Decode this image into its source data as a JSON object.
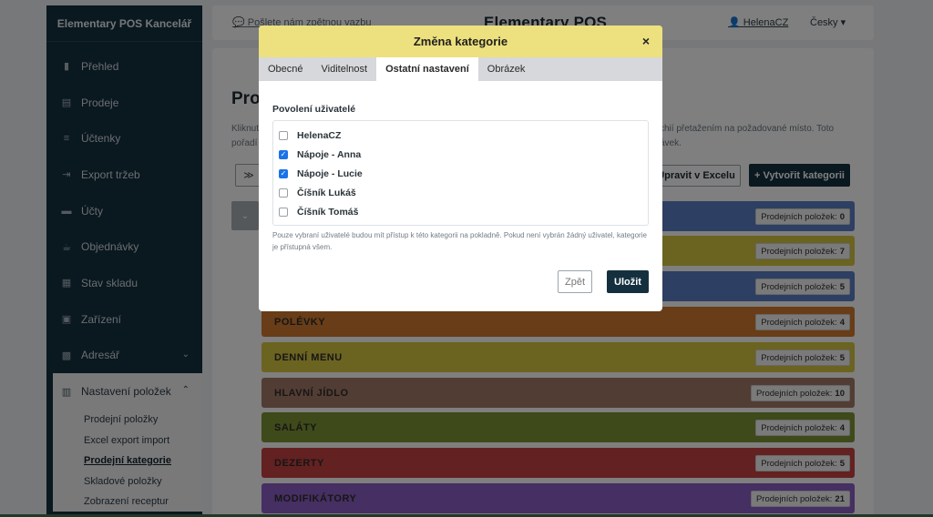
{
  "sidebar": {
    "brand": "Elementary POS Kancelář",
    "items": [
      {
        "label": "Přehled",
        "icon": "chart-icon"
      },
      {
        "label": "Prodeje",
        "icon": "sales-icon"
      },
      {
        "label": "Účtenky",
        "icon": "receipts-icon"
      },
      {
        "label": "Export tržeb",
        "icon": "export-icon"
      },
      {
        "label": "Účty",
        "icon": "accounts-icon"
      },
      {
        "label": "Objednávky",
        "icon": "orders-icon"
      },
      {
        "label": "Stav skladu",
        "icon": "warehouse-icon"
      },
      {
        "label": "Zařízení",
        "icon": "device-icon"
      },
      {
        "label": "Adresář",
        "icon": "address-book-icon"
      }
    ],
    "group": {
      "label": "Nastavení položek",
      "subitems": [
        "Prodejní položky",
        "Excel export import",
        "Prodejní kategorie",
        "Skladové položky",
        "Zobrazení receptur"
      ]
    }
  },
  "topbar": {
    "feedback": "Pošlete nám zpětnou vazbu",
    "logo": "Elementary POS",
    "user": "HelenaCZ",
    "language": "Česky"
  },
  "main": {
    "title": "Prod",
    "desc_left_1": "Kliknut",
    "desc_left_2": "pořadí",
    "desc_right_1": "chií přetažením na požadované místo. Toto",
    "desc_right_2": "ávek.",
    "excel_button": "Upravit v Excelu",
    "create_button": "+ Vytvořit kategorii",
    "count_label": "Prodejních položek:",
    "categories": [
      {
        "name": "",
        "count": "0",
        "color": "#5b7fc4"
      },
      {
        "name": "",
        "count": "7",
        "color": "#d7c640"
      },
      {
        "name": "",
        "count": "5",
        "color": "#5b7fc4"
      },
      {
        "name": "POLÉVKY",
        "count": "4",
        "color": "#d07b2e"
      },
      {
        "name": "DENNÍ MENU",
        "count": "5",
        "color": "#d7c640"
      },
      {
        "name": "HLAVNÍ JÍDLO",
        "count": "10",
        "color": "#a57b68"
      },
      {
        "name": "SALÁTY",
        "count": "4",
        "color": "#7c9434"
      },
      {
        "name": "DEZERTY",
        "count": "5",
        "color": "#c84343"
      },
      {
        "name": "MODIFIKÁTORY",
        "count": "21",
        "color": "#8d5fc4"
      }
    ]
  },
  "modal": {
    "title": "Změna kategorie",
    "close": "×",
    "tabs": [
      "Obecné",
      "Viditelnost",
      "Ostatní nastavení",
      "Obrázek"
    ],
    "active_tab": "Ostatní nastavení",
    "section_label": "Povolení uživatelé",
    "users": [
      {
        "name": "HelenaCZ",
        "checked": false
      },
      {
        "name": "Nápoje - Anna",
        "checked": true
      },
      {
        "name": "Nápoje - Lucie",
        "checked": true
      },
      {
        "name": "Číšník Lukáš",
        "checked": false
      },
      {
        "name": "Číšník Tomáš",
        "checked": false
      }
    ],
    "help": "Pouze vybraní uživatelé budou mít přístup k této kategorii na pokladně. Pokud není vybrán žádný uživatel, kategorie je přístupná všem.",
    "back_button": "Zpět",
    "save_button": "Uložit"
  }
}
